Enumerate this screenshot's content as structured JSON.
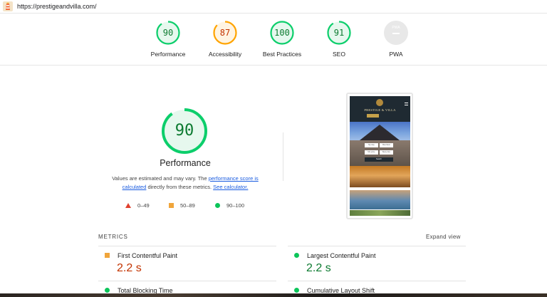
{
  "topbar": {
    "url": "https://prestigeandvilla.com/",
    "logo_icon": "lighthouse-icon"
  },
  "summary": {
    "gauges": [
      {
        "label": "Performance",
        "score": "90",
        "level": 0.9,
        "color": "#0cce6b",
        "text_color": "#0c7a30",
        "fill": "#e6f8ee"
      },
      {
        "label": "Accessibility",
        "score": "87",
        "level": 0.87,
        "color": "#ffa400",
        "text_color": "#c33300",
        "fill": "#fff4e2"
      },
      {
        "label": "Best Practices",
        "score": "100",
        "level": 1.0,
        "color": "#0cce6b",
        "text_color": "#0c7a30",
        "fill": "#e6f8ee"
      },
      {
        "label": "SEO",
        "score": "91",
        "level": 0.91,
        "color": "#0cce6b",
        "text_color": "#0c7a30",
        "fill": "#e6f8ee"
      }
    ],
    "pwa": {
      "label": "PWA",
      "badge_text": "PWA"
    }
  },
  "performance": {
    "score": "90",
    "level": 0.9,
    "title": "Performance",
    "desc_prefix": "Values are estimated and may vary. The ",
    "desc_link1": "performance score is calculated",
    "desc_middle": " directly from these metrics. ",
    "desc_link2": "See calculator.",
    "legend": [
      {
        "icon": "fail-triangle-icon",
        "range": "0–49",
        "color": "#e0412f"
      },
      {
        "icon": "average-square-icon",
        "range": "50–89",
        "color": "#f0a53b"
      },
      {
        "icon": "pass-circle-icon",
        "range": "90–100",
        "color": "#0cc55a"
      }
    ]
  },
  "screenshot": {
    "brand": "PRESTIGE & VILLA",
    "field1": "My stay",
    "field2": "Max Mem",
    "field3": "Min price",
    "field4": "Best price",
    "search": "Search"
  },
  "metrics": {
    "title": "METRICS",
    "expand_label": "Expand view",
    "items": [
      {
        "name": "First Contentful Paint",
        "value": "2.2 s",
        "status": "average"
      },
      {
        "name": "Largest Contentful Paint",
        "value": "2.2 s",
        "status": "pass"
      },
      {
        "name": "Total Blocking Time",
        "value": "",
        "status": "pass"
      },
      {
        "name": "Cumulative Layout Shift",
        "value": "",
        "status": "pass"
      }
    ]
  },
  "colors": {
    "pass": "#0cce6b",
    "average": "#ffa400",
    "fail": "#ff4e42",
    "link": "#1a5ce0"
  }
}
